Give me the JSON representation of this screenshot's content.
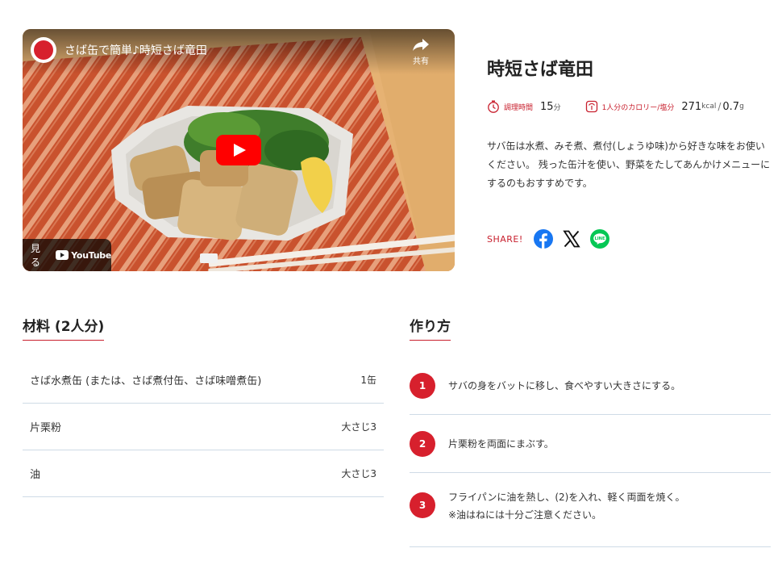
{
  "video": {
    "title": "さば缶で簡単♪時短さば竜田",
    "share_label": "共有",
    "watch_label": "見る",
    "youtube_label": "YouTube"
  },
  "recipe": {
    "title": "時短さば竜田",
    "cook_time_label": "調理時間",
    "cook_time_value": "15",
    "cook_time_unit": "分",
    "calorie_label": "1人分のカロリー/塩分",
    "calorie_value": "271",
    "calorie_unit": "kcal",
    "salt_value": "0.7",
    "salt_unit": "g",
    "description": "サバ缶は水煮、みそ煮、煮付(しょうゆ味)から好きな味をお使いください。 残った缶汁を使い、野菜をたしてあんかけメニューにするのもおすすめです。"
  },
  "share": {
    "label": "SHARE!",
    "icons": [
      "facebook-icon",
      "x-icon",
      "line-icon"
    ]
  },
  "ingredients": {
    "heading": "材料 (2人分)",
    "items": [
      {
        "name": "さば水煮缶 (または、さば煮付缶、さば味噌煮缶)",
        "amount": "1缶"
      },
      {
        "name": "片栗粉",
        "amount": "大さじ3"
      },
      {
        "name": "油",
        "amount": "大さじ3"
      }
    ]
  },
  "steps": {
    "heading": "作り方",
    "items": [
      {
        "num": "1",
        "text": "サバの身をバットに移し、食べやすい大きさにする。",
        "note": ""
      },
      {
        "num": "2",
        "text": "片栗粉を両面にまぶす。",
        "note": ""
      },
      {
        "num": "3",
        "text": "フライパンに油を熱し、(2)を入れ、軽く両面を焼く。",
        "note": "※油はねには十分ご注意ください。"
      }
    ]
  },
  "colors": {
    "accent": "#c8202e",
    "divider": "#cfdbe6",
    "facebook": "#1877f2",
    "line": "#06c755",
    "youtube": "#ff0000"
  }
}
